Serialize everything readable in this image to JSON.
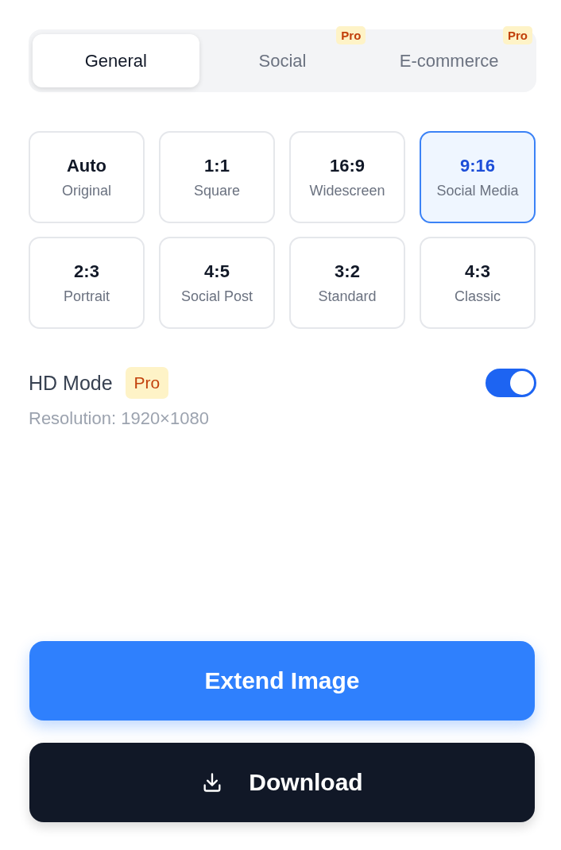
{
  "tabs": [
    {
      "label": "General",
      "selected": true
    },
    {
      "label": "Social",
      "selected": false,
      "badge": "Pro"
    },
    {
      "label": "E-commerce",
      "selected": false,
      "badge": "Pro"
    }
  ],
  "ratios": [
    {
      "ratio": "Auto",
      "name": "Original",
      "selected": false
    },
    {
      "ratio": "1:1",
      "name": "Square",
      "selected": false
    },
    {
      "ratio": "16:9",
      "name": "Widescreen",
      "selected": false
    },
    {
      "ratio": "9:16",
      "name": "Social Media",
      "selected": true
    },
    {
      "ratio": "2:3",
      "name": "Portrait",
      "selected": false
    },
    {
      "ratio": "4:5",
      "name": "Social Post",
      "selected": false
    },
    {
      "ratio": "3:2",
      "name": "Standard",
      "selected": false
    },
    {
      "ratio": "4:3",
      "name": "Classic",
      "selected": false
    }
  ],
  "hd_mode": {
    "label": "HD Mode",
    "badge": "Pro",
    "on": true,
    "resolution": "Resolution: 1920×1080"
  },
  "buttons": {
    "extend": "Extend Image",
    "download": "Download"
  }
}
